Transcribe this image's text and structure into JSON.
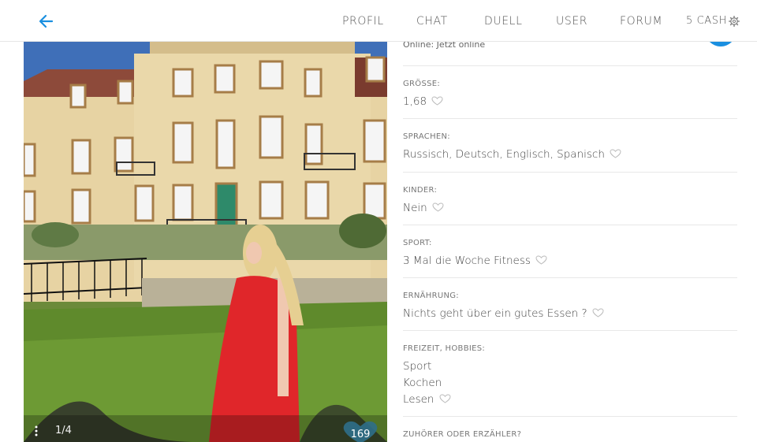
{
  "nav": {
    "profil": "PROFIL",
    "chat": "CHAT",
    "duell": "DUELL",
    "user": "USER",
    "forum": "FORUM",
    "cash": "5 CASH"
  },
  "icons": {
    "back": "arrow-left-icon",
    "settings": "gear-icon",
    "more": "more-vertical-icon",
    "like": "heart-icon"
  },
  "colors": {
    "accent": "#1a8fe0",
    "dress": "#e0262a"
  },
  "photo": {
    "counter": "1/4",
    "likes": "169"
  },
  "profile": {
    "online": "Online: Jetzt online",
    "sections": [
      {
        "label": "GRÖSSE:",
        "value": "1,68"
      },
      {
        "label": "SPRACHEN:",
        "value": "Russisch, Deutsch, Englisch, Spanisch"
      },
      {
        "label": "KINDER:",
        "value": "Nein"
      },
      {
        "label": "SPORT:",
        "value": "3 Mal die Woche Fitness"
      },
      {
        "label": "ERNÄHRUNG:",
        "value": "Nichts geht über ein gutes Essen ?"
      },
      {
        "label": "FREIZEIT, HOBBIES:",
        "values": [
          "Sport",
          "Kochen",
          "Lesen"
        ]
      },
      {
        "label": "ZUHÖRER ODER ERZÄHLER?"
      }
    ]
  }
}
